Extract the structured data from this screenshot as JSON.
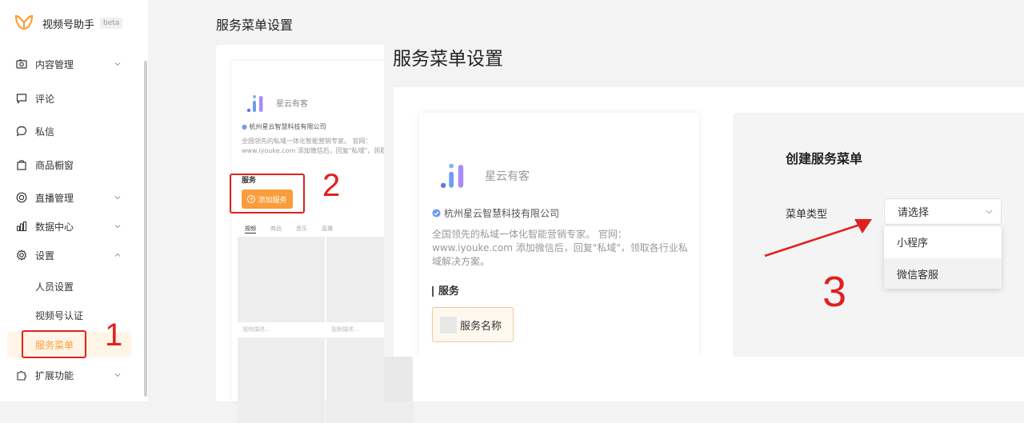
{
  "app": {
    "title": "视频号助手",
    "badge": "beta"
  },
  "sidebar": {
    "items": [
      {
        "label": "内容管理",
        "icon": "camera-icon",
        "expandable": true
      },
      {
        "label": "评论",
        "icon": "comment-icon",
        "expandable": false
      },
      {
        "label": "私信",
        "icon": "chat-bubble-icon",
        "expandable": false
      },
      {
        "label": "商品橱窗",
        "icon": "shopping-bag-icon",
        "expandable": false
      },
      {
        "label": "直播管理",
        "icon": "live-icon",
        "expandable": true
      },
      {
        "label": "数据中心",
        "icon": "bar-chart-icon",
        "expandable": true
      },
      {
        "label": "设置",
        "icon": "gear-icon",
        "expandable": true
      }
    ],
    "settings_children": [
      {
        "label": "人员设置",
        "active": false
      },
      {
        "label": "视频号认证",
        "active": false
      },
      {
        "label": "服务菜单",
        "active": true
      }
    ],
    "extension": {
      "label": "扩展功能",
      "icon": "extension-icon",
      "expandable": true
    }
  },
  "page": {
    "title": "服务菜单设置"
  },
  "profile": {
    "name": "星云有客",
    "company": "杭州星云智慧科技有限公司",
    "description": "全国领先的私域一体化智能营销专家。 官网：www.iyouke.com 添加微信后，回复\"私域\"，领取各行业私域解决方案。",
    "back_description_line1": "全国领先的私域一体化智能营销专家。 官网：",
    "back_description_line2": "www.iyouke.com 添加微信后，回复\"私域\"，领取",
    "section_title": "服务",
    "add_service_label": "添加服务",
    "service_item_label": "服务名称",
    "tabs": [
      "视频",
      "商品",
      "音乐",
      "直播"
    ],
    "video_caption": "视频描述..."
  },
  "form": {
    "title": "创建服务菜单",
    "menu_type_label": "菜单类型",
    "select_placeholder": "请选择",
    "options": [
      {
        "label": "小程序",
        "hovered": false
      },
      {
        "label": "微信客服",
        "hovered": true
      }
    ]
  },
  "annotations": {
    "step1": "1",
    "step2": "2",
    "step3": "3"
  },
  "colors": {
    "accent": "#fa9d3b",
    "annotation_red": "#e02020",
    "active_bg": "#fff5e6"
  }
}
